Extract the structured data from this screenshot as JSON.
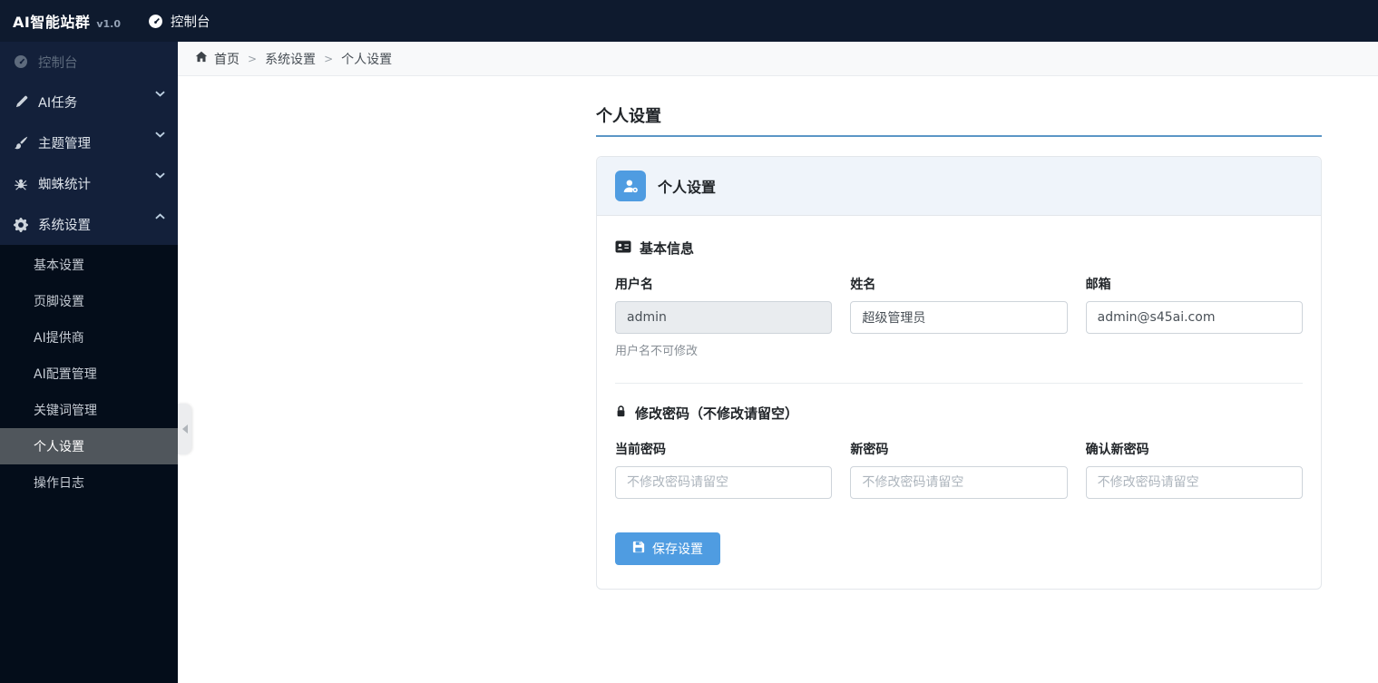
{
  "topbar": {
    "brand": "AI智能站群",
    "version": "v1.0",
    "console": "控制台"
  },
  "sidebar": {
    "console": "控制台",
    "items": [
      {
        "label": "AI任务",
        "icon": "pen-icon"
      },
      {
        "label": "主题管理",
        "icon": "brush-icon"
      },
      {
        "label": "蜘蛛统计",
        "icon": "spider-icon"
      },
      {
        "label": "系统设置",
        "icon": "gear-icon"
      }
    ],
    "submenu": [
      "基本设置",
      "页脚设置",
      "AI提供商",
      "AI配置管理",
      "关键词管理",
      "个人设置",
      "操作日志"
    ],
    "active_submenu": "个人设置"
  },
  "breadcrumb": {
    "home": "首页",
    "section": "系统设置",
    "current": "个人设置",
    "separator": ">"
  },
  "page": {
    "title": "个人设置"
  },
  "card": {
    "header_title": "个人设置",
    "basic": {
      "section_title": "基本信息",
      "hint": "用户名不可修改",
      "fields": [
        {
          "label": "用户名",
          "value": "admin"
        },
        {
          "label": "姓名",
          "value": "超级管理员"
        },
        {
          "label": "邮箱",
          "value": "admin@s45ai.com"
        }
      ]
    },
    "password": {
      "section_title": "修改密码（不修改请留空）",
      "fields": [
        {
          "label": "当前密码",
          "placeholder": "不修改密码请留空"
        },
        {
          "label": "新密码",
          "placeholder": "不修改密码请留空"
        },
        {
          "label": "确认新密码",
          "placeholder": "不修改密码请留空"
        }
      ]
    },
    "save_button": "保存设置"
  },
  "colors": {
    "topbar_bg": "#0e1a2e",
    "sidebar_bg": "#13203a",
    "submenu_bg": "#040d1a",
    "active_item_bg": "#50565c",
    "accent_blue": "#4f9ce1",
    "title_underline": "#5b96c6",
    "card_header_bg": "#eff4fa"
  }
}
